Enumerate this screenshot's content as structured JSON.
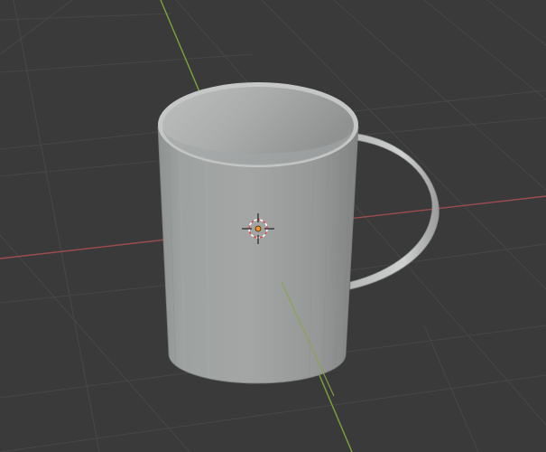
{
  "viewport": {
    "kind": "3d-viewport",
    "background_color": "#3a3a3a",
    "grid_line_color": "#4a4a4a",
    "x_axis_color": "#9e4d4f",
    "y_axis_color": "#7ca43c"
  },
  "scene": {
    "object": "mug",
    "object_color": "#9a9c9c",
    "origin_marker": "orange-dot",
    "cursor_icon": "3d-cursor-icon"
  }
}
